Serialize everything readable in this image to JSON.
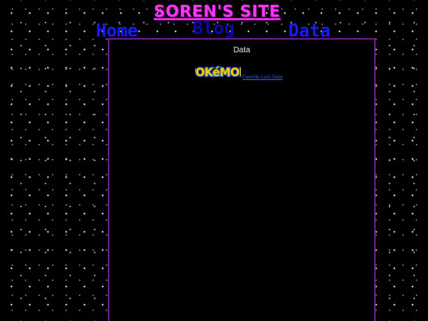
{
  "header": {
    "site_title": "SOREN'S SITE"
  },
  "nav": {
    "home": "Home",
    "blog": "Blog",
    "data": "Data"
  },
  "content": {
    "heading": "Data",
    "pokemon_link": {
      "logo_text": "POKéMON",
      "caption": "Favorite Loss Data"
    }
  },
  "colors": {
    "background": "#000000",
    "title": "#ff33ff",
    "nav_link": "#1a1aff",
    "content_border": "#6a1a8a"
  }
}
